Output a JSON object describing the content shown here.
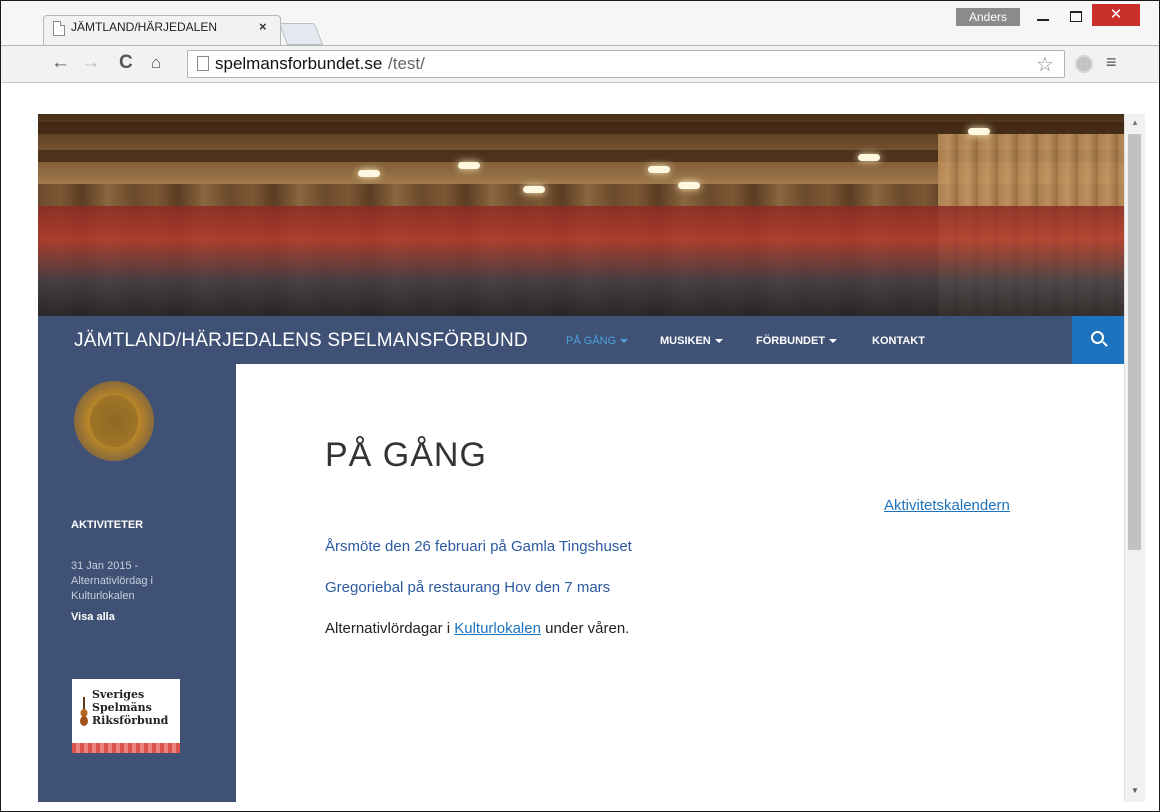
{
  "window": {
    "user_name": "Anders",
    "close_glyph": "✕"
  },
  "tab": {
    "title": "JÄMTLAND/HÄRJEDALEN",
    "close_glyph": "×"
  },
  "toolbar": {
    "back_glyph": "←",
    "forward_glyph": "→",
    "reload_glyph": "C",
    "home_glyph": "⌂",
    "url_host": "spelmansforbundet.se",
    "url_path": "/test/",
    "star_glyph": "☆",
    "menu_glyph": "≡"
  },
  "site": {
    "title": "JÄMTLAND/HÄRJEDALENS SPELMANSFÖRBUND",
    "nav": [
      {
        "label": "PÅ GÅNG",
        "has_caret": true,
        "active": true
      },
      {
        "label": "MUSIKEN",
        "has_caret": true,
        "active": false
      },
      {
        "label": "FÖRBUNDET",
        "has_caret": true,
        "active": false
      },
      {
        "label": "KONTAKT",
        "has_caret": false,
        "active": false
      }
    ],
    "accent_color": "#3f5175",
    "active_nav_color": "#4aa3df",
    "search_button_color": "#1e73be"
  },
  "sidebar": {
    "heading": "AKTIVITETER",
    "event": "31 Jan 2015 - Alternativlördag i Kulturlokalen",
    "show_all": "Visa alla",
    "riks_logo_text": [
      "Sveriges",
      "Spelmäns",
      "Riksförbund"
    ]
  },
  "content": {
    "title": "PÅ GÅNG",
    "calendar_link": "Aktivitetskalendern",
    "posts": [
      "Årsmöte den 26 februari på Gamla Tingshuset",
      "Gregoriebal på restaurang Hov den 7 mars"
    ],
    "text_before": "Alternativlördagar i ",
    "text_link": "Kulturlokalen",
    "text_after": " under våren."
  },
  "scrollbar": {
    "up_glyph": "▲",
    "down_glyph": "▼"
  }
}
